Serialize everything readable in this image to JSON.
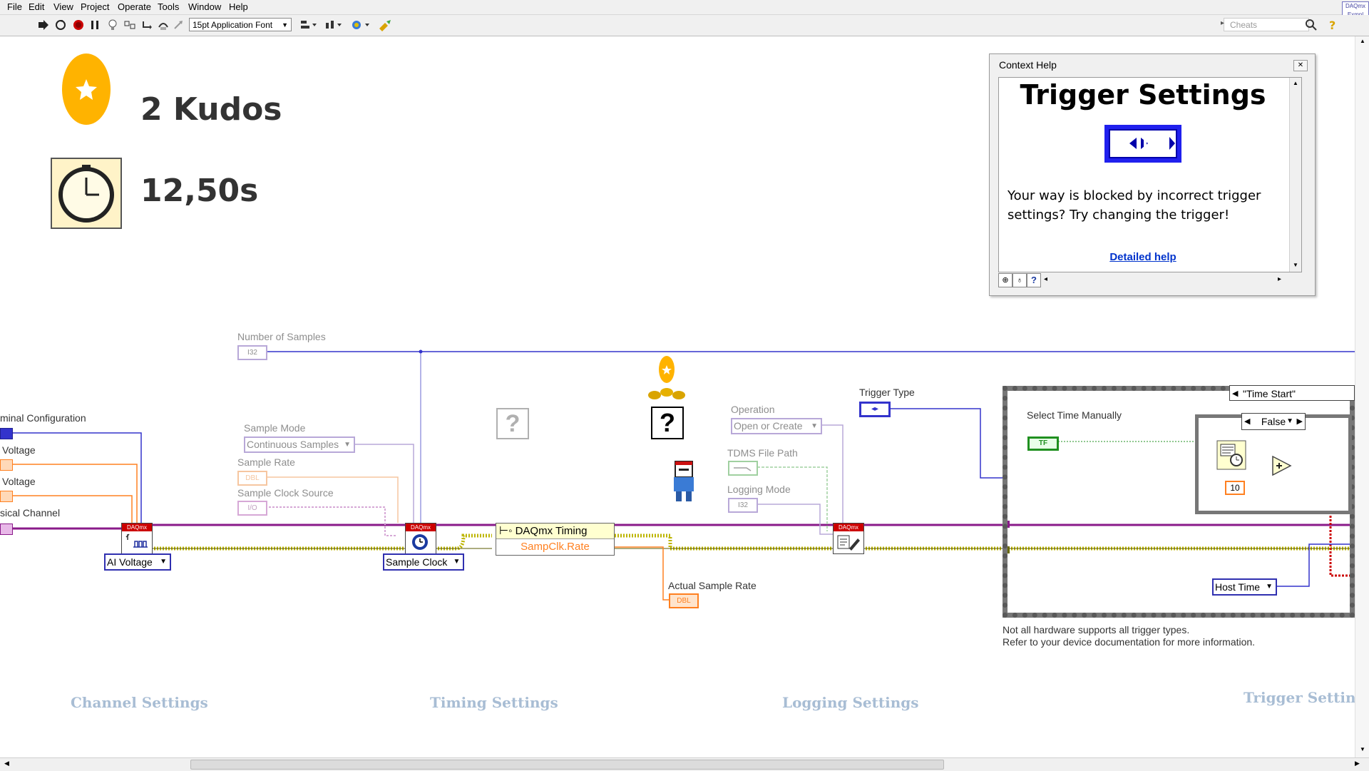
{
  "menu": [
    "File",
    "Edit",
    "View",
    "Project",
    "Operate",
    "Tools",
    "Window",
    "Help"
  ],
  "toolbar": {
    "font": "15pt Application Font",
    "search_placeholder": "Cheats"
  },
  "stats": {
    "kudos": "2 Kudos",
    "time": "12,50s"
  },
  "context_help": {
    "title": "Context Help",
    "heading": "Trigger Settings",
    "description": "Your way is blocked by incorrect trigger settings? Try changing the trigger!",
    "link": "Detailed help"
  },
  "diagram": {
    "channel": {
      "terminal_configuration": "minal Configuration",
      "max_voltage": "Voltage",
      "min_voltage": "Voltage",
      "physical_channel": "sical Channel",
      "ai_voltage": "AI Voltage"
    },
    "timing": {
      "number_of_samples": "Number of Samples",
      "sample_mode": "Sample Mode",
      "sample_mode_value": "Continuous Samples",
      "sample_rate": "Sample Rate",
      "sample_clock_source": "Sample Clock Source",
      "sample_clock": "Sample Clock",
      "daqmx_timing": "DAQmx Timing",
      "sampclk_rate": "SampClk.Rate",
      "actual_sample_rate": "Actual Sample Rate"
    },
    "logging": {
      "operation": "Operation",
      "operation_value": "Open or Create",
      "tdms_file_path": "TDMS File Path",
      "logging_mode": "Logging Mode"
    },
    "trigger": {
      "trigger_type": "Trigger Type",
      "case_label": "\"Time Start\"",
      "select_time_manually": "Select Time Manually",
      "false_case": "False",
      "constant_10": "10",
      "host_time": "Host Time",
      "note_line1": "Not all hardware supports all trigger types.",
      "note_line2": "Refer to your device documentation for more information."
    },
    "terminals": {
      "i32": "I32",
      "dbl": "DBL",
      "io": "I/O",
      "tf": "TF",
      "daqmx": "DAQmx"
    },
    "sections": {
      "channel": "Channel Settings",
      "timing": "Timing Settings",
      "logging": "Logging Settings",
      "trigger": "Trigger Settings"
    }
  },
  "colors": {
    "error_cluster": "#bdb400",
    "task_wire": "#8a1a8a",
    "i32_wire": "#3333cc",
    "dbl_wire": "#ff8020",
    "bool_wire": "#209020",
    "section_label": "#a8bdd4"
  }
}
